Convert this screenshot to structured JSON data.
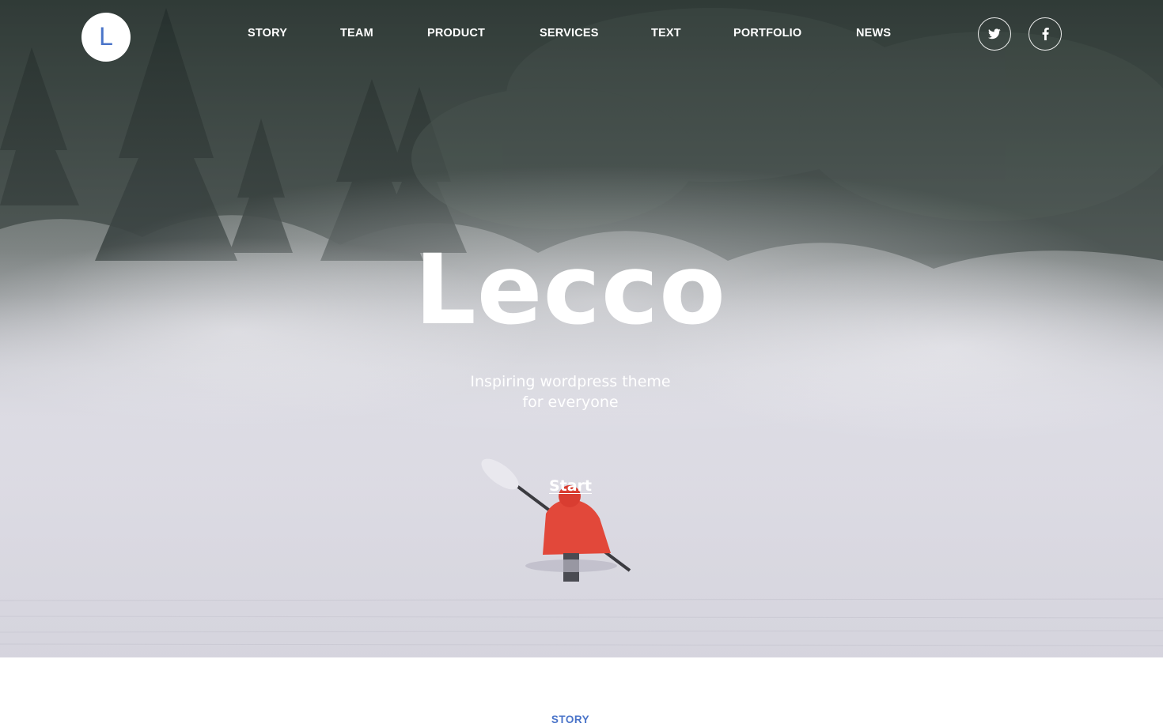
{
  "brand": {
    "logo_letter": "L",
    "accent_color": "#4a74c9"
  },
  "nav": {
    "items": [
      {
        "label": "STORY"
      },
      {
        "label": "TEAM"
      },
      {
        "label": "PRODUCT"
      },
      {
        "label": "SERVICES"
      },
      {
        "label": "TEXT"
      },
      {
        "label": "PORTFOLIO"
      },
      {
        "label": "NEWS"
      }
    ]
  },
  "social": {
    "icons": [
      "twitter-icon",
      "facebook-icon"
    ]
  },
  "hero": {
    "title": "Lecco",
    "subtitle_line1": "Inspiring wordpress theme",
    "subtitle_line2": "for everyone",
    "cta_label": "Start"
  },
  "next_section": {
    "label": "STORY"
  }
}
